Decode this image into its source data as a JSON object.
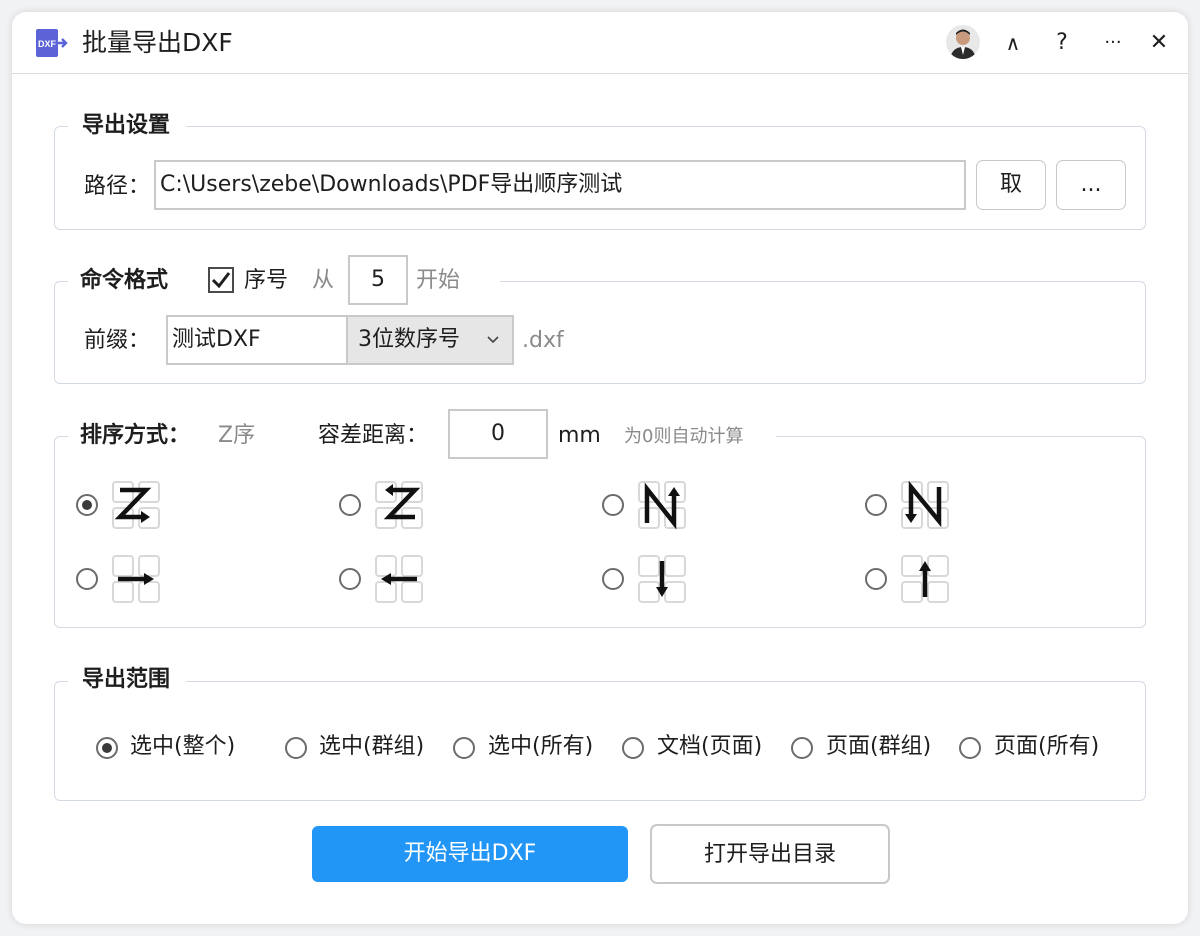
{
  "window": {
    "title": "批量导出DXF",
    "app_icon_text": "DXF"
  },
  "titlebar": {
    "collapse": "∧",
    "help": "?",
    "more": "···",
    "close": "✕"
  },
  "export_settings": {
    "legend": "导出设置",
    "path_label": "路径：",
    "path_value": "C:\\Users\\zebe\\Downloads\\PDF导出顺序测试",
    "fetch_button": "取",
    "browse_button": "..."
  },
  "command_format": {
    "legend": "命令格式",
    "seq_checked": true,
    "seq_label": "序号",
    "from_label": "从",
    "start_value": "5",
    "start_suffix": "开始",
    "prefix_label": "前缀：",
    "prefix_value": "测试DXF",
    "digits_selected": "3位数序号",
    "extension": ".dxf"
  },
  "sort": {
    "legend": "排序方式：",
    "current_mode": "Z序",
    "tolerance_label": "容差距离：",
    "tolerance_value": "0",
    "tolerance_unit": "mm",
    "tolerance_hint": "为0则自动计算",
    "options": [
      {
        "icon": "z-order-right-icon",
        "selected": true
      },
      {
        "icon": "z-order-left-icon",
        "selected": false
      },
      {
        "icon": "n-order-up-icon",
        "selected": false
      },
      {
        "icon": "n-order-down-icon",
        "selected": false
      },
      {
        "icon": "row-right-icon",
        "selected": false
      },
      {
        "icon": "row-left-icon",
        "selected": false
      },
      {
        "icon": "column-down-icon",
        "selected": false
      },
      {
        "icon": "column-up-icon",
        "selected": false
      }
    ]
  },
  "range": {
    "legend": "导出范围",
    "options": [
      {
        "label": "选中(整个)",
        "selected": true
      },
      {
        "label": "选中(群组)",
        "selected": false
      },
      {
        "label": "选中(所有)",
        "selected": false
      },
      {
        "label": "文档(页面)",
        "selected": false
      },
      {
        "label": "页面(群组)",
        "selected": false
      },
      {
        "label": "页面(所有)",
        "selected": false
      }
    ]
  },
  "actions": {
    "start_export": "开始导出DXF",
    "open_dir": "打开导出目录"
  },
  "colors": {
    "primary": "#2196f6",
    "border": "#d4dae1"
  }
}
